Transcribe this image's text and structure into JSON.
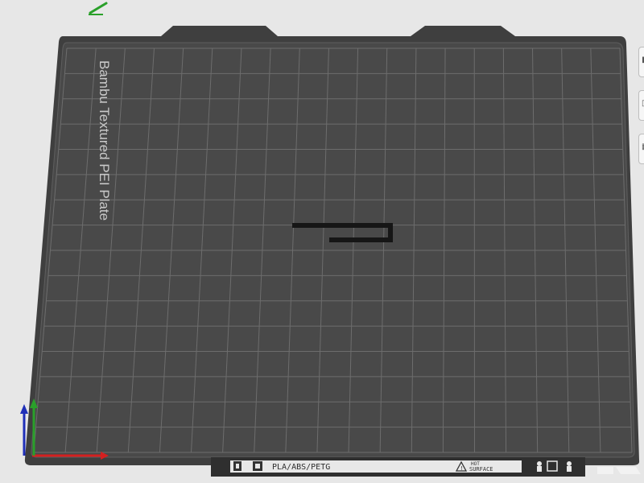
{
  "plate": {
    "name": "Bambu Textured PEI Plate",
    "material_label": "PLA/ABS/PETG",
    "warning_label_line1": "HOT",
    "warning_label_line2": "SURFACE"
  },
  "colors": {
    "background": "#e7e7e7",
    "plate_frame": "#3f3f3f",
    "plate_surface": "#484848",
    "grid_line": "#6a6a6a",
    "axis_x": "#d42020",
    "axis_y": "#2aa02a",
    "axis_z": "#1f2fb8",
    "object": "#161616"
  },
  "icons": {
    "top_left_tool": "edit-pen-icon",
    "side_toolbar": [
      "view-icon",
      "layout-icon",
      "arrange-icon"
    ],
    "plate_badges": [
      "printer-icon",
      "qr-icon",
      "warning-icon",
      "person-icon"
    ]
  }
}
